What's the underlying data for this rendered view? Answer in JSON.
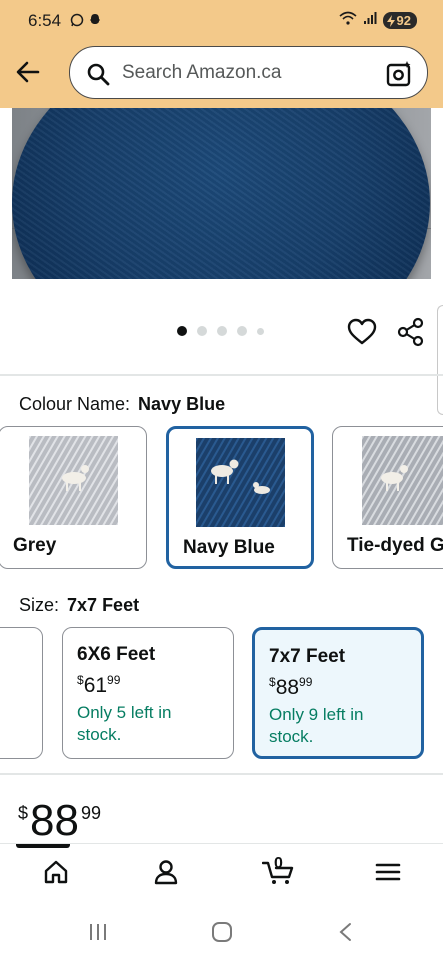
{
  "status_bar": {
    "time": "6:54",
    "battery": "92"
  },
  "search": {
    "placeholder": "Search Amazon.ca"
  },
  "gallery": {
    "image_count": 5,
    "active_index": 0
  },
  "colour": {
    "label": "Colour Name:",
    "selected": "Navy Blue",
    "options": [
      {
        "name": "Grey"
      },
      {
        "name": "Navy Blue"
      },
      {
        "name": "Tie-dyed G"
      }
    ]
  },
  "size": {
    "label": "Size:",
    "selected": "7x7 Feet",
    "options": [
      {
        "name": "6X6 Feet",
        "currency": "$",
        "whole": "61",
        "fraction": "99",
        "stock": "Only 5 left in stock."
      },
      {
        "name": "7x7 Feet",
        "currency": "$",
        "whole": "88",
        "fraction": "99",
        "stock": "Only 9 left in stock."
      }
    ]
  },
  "price": {
    "currency": "$",
    "whole": "88",
    "fraction": "99"
  },
  "bottom_nav": {
    "cart_count": "0",
    "items": [
      "home-icon",
      "account-icon",
      "cart-icon",
      "menu-icon"
    ]
  },
  "colors": {
    "header_bg": "#f3c98a",
    "selected_border": "#2162a1",
    "stock_green": "#067d62"
  }
}
